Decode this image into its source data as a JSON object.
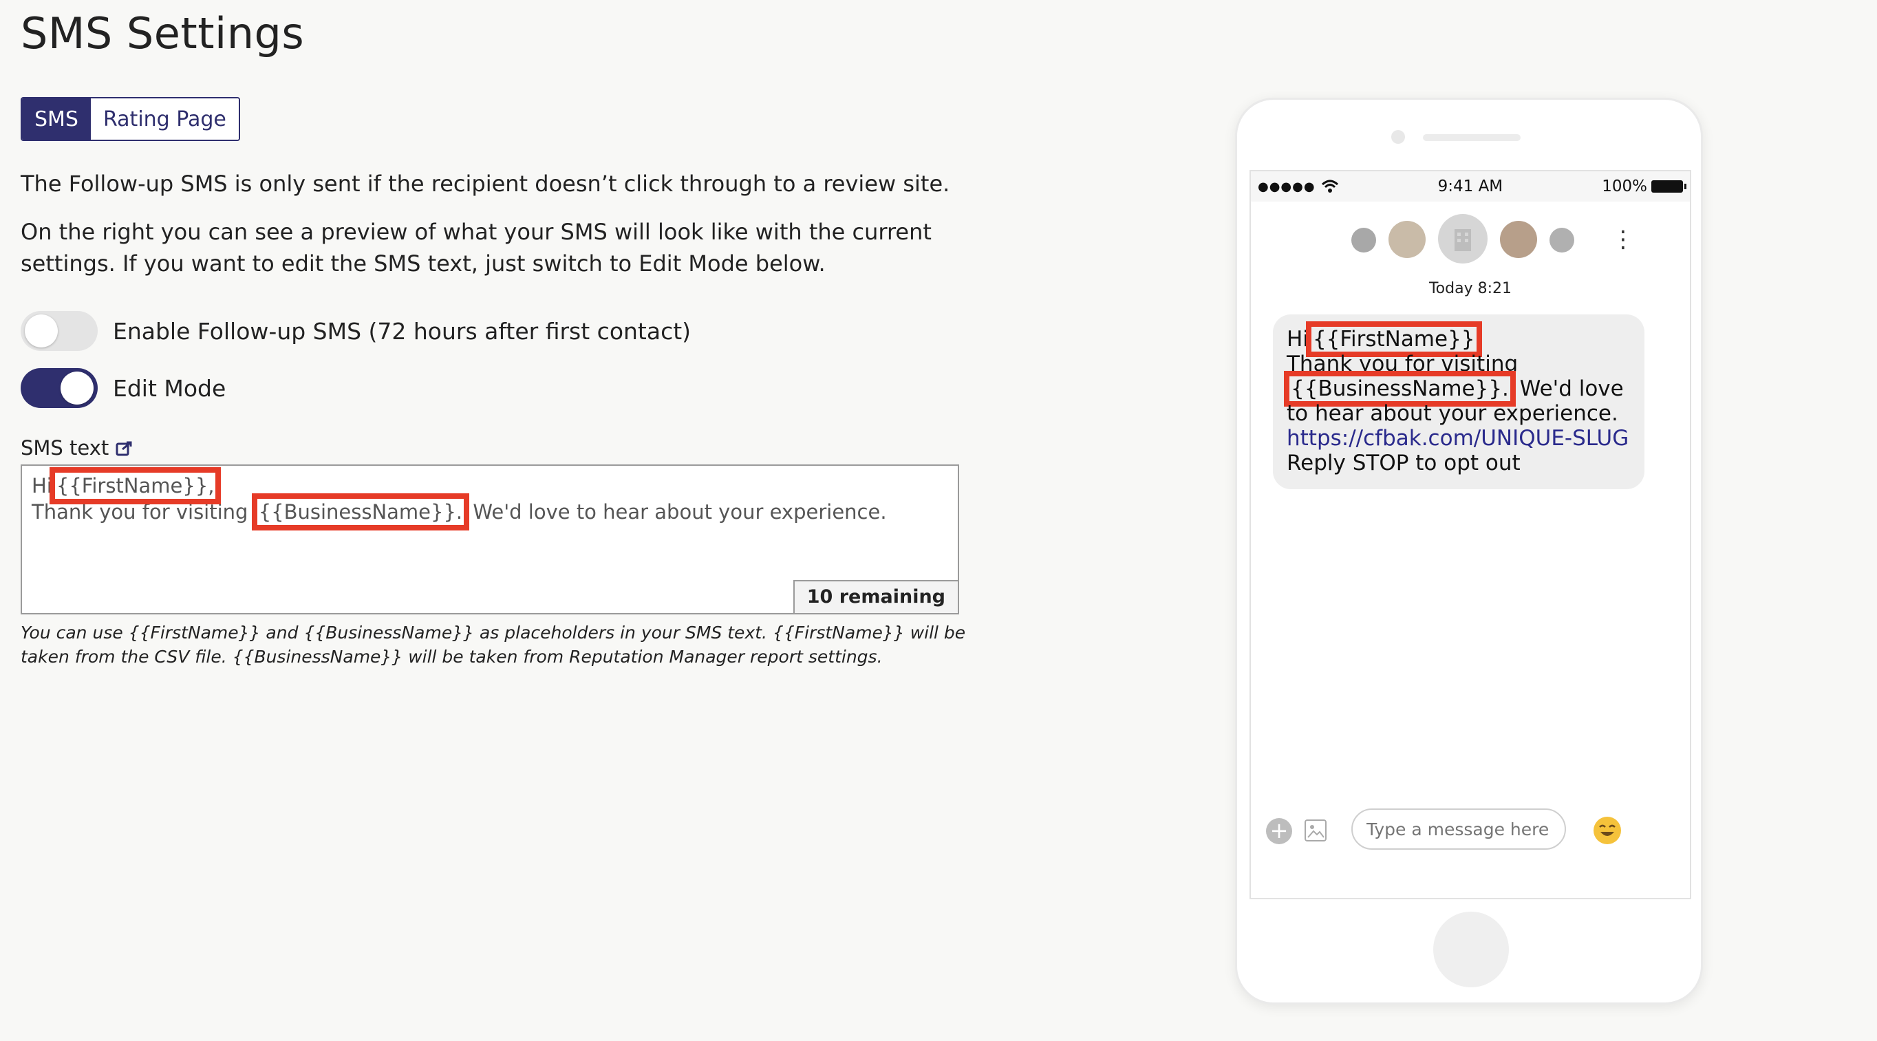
{
  "page": {
    "title": "SMS Settings"
  },
  "tabs": [
    {
      "label": "SMS",
      "active": true
    },
    {
      "label": "Rating Page",
      "active": false
    }
  ],
  "info": {
    "p1": "The Follow-up SMS is only sent if the recipient doesn’t click through to a review site.",
    "p2": "On the right you can see a preview of what your SMS will look like with the current settings. If you want to edit the SMS text, just switch to Edit Mode below."
  },
  "toggles": {
    "followup": {
      "label": "Enable Follow-up SMS (72 hours after first contact)",
      "on": false
    },
    "edit_mode": {
      "label": "Edit Mode",
      "on": true
    }
  },
  "sms_text": {
    "label": "SMS text",
    "line1_prefix": "Hi",
    "first_placeholder": "{{FirstName}},",
    "line2_prefix": "Thank you for visiting",
    "business_placeholder": "{{BusinessName}}.",
    "line2_suffix": "We'd love to hear about your experience.",
    "remaining": "10 remaining",
    "helper": "You can use {{FirstName}} and {{BusinessName}} as placeholders in your SMS text. {{FirstName}} will be taken from the CSV file. {{BusinessName}} will be taken from Reputation Manager report settings."
  },
  "phone": {
    "status": {
      "signal": "●●●●●",
      "time": "9:41 AM",
      "battery": "100%"
    },
    "timestamp": "Today 8:21",
    "message": {
      "hi": "Hi",
      "first": "{{FirstName}}",
      "thanks": "Thank you for visiting",
      "business": "{{BusinessName}}.",
      "love": "We'd love to hear about your experience.",
      "link": "https://cfbak.com/UNIQUE-SLUG",
      "stop": "Reply STOP to opt out"
    },
    "composer_placeholder": "Type a message here",
    "icons": {
      "wifi": "wifi-icon",
      "more": "kebab-menu-icon",
      "add": "plus-icon",
      "image": "image-icon",
      "emoji": "emoji-icon"
    }
  }
}
